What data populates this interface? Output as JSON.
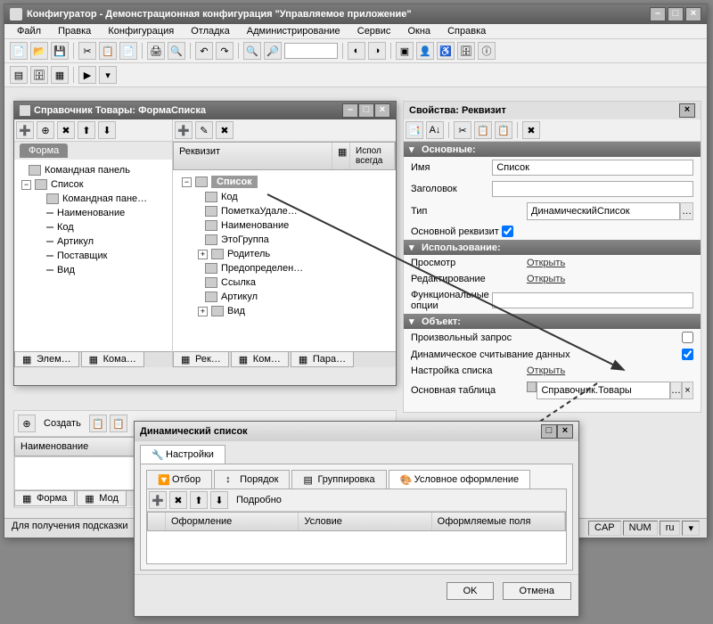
{
  "main_window": {
    "title": "Конфигуратор - Демонстрационная конфигурация \"Управляемое приложение\""
  },
  "menu": {
    "items": [
      "Файл",
      "Правка",
      "Конфигурация",
      "Отладка",
      "Администрирование",
      "Сервис",
      "Окна",
      "Справка"
    ]
  },
  "form_panel": {
    "title": "Справочник Товары: ФормаСписка",
    "tab_form": "Форма",
    "tree_items": [
      "Командная панель",
      "Список",
      "Командная пане…",
      "Наименование",
      "Код",
      "Артикул",
      "Поставщик",
      "Вид"
    ],
    "bottom_tabs": [
      "Элем…",
      "Кома…"
    ]
  },
  "rekvizit": {
    "header_col1": "Реквизит",
    "header_col2": "Испол\nвсегда",
    "items": [
      "Список",
      "Код",
      "ПометкаУдале…",
      "Наименование",
      "ЭтоГруппа",
      "Родитель",
      "Предопределен…",
      "Ссылка",
      "Артикул",
      "Вид"
    ],
    "bottom_tabs": [
      "Рек…",
      "Ком…",
      "Пара…"
    ]
  },
  "props_panel": {
    "title": "Свойства: Реквизит",
    "sections": {
      "main": "Основные:",
      "use": "Использование:",
      "object": "Объект:"
    },
    "fields": {
      "name_label": "Имя",
      "name_value": "Список",
      "zagolovok_label": "Заголовок",
      "zagolovok_value": "",
      "tip_label": "Тип",
      "tip_value": "ДинамическийСписок",
      "main_rekvizit_label": "Основной реквизит",
      "main_rekvizit_checked": true,
      "prosmotr_label": "Просмотр",
      "prosmotr_link": "Открыть",
      "redakt_label": "Редактирование",
      "redakt_link": "Открыть",
      "func_opt_label": "Функциональные опции",
      "func_opt_value": "",
      "proizv_label": "Произвольный запрос",
      "proizv_checked": false,
      "dyn_read_label": "Динамическое считывание данных",
      "dyn_read_checked": true,
      "nastroyka_label": "Настройка списка",
      "nastroyka_link": "Открыть",
      "osn_tab_label": "Основная таблица",
      "osn_tab_value": "Справочник.Товары"
    }
  },
  "sub_panel": {
    "create": "Создать",
    "col_name": "Наименование",
    "bottom_tabs": [
      "Форма",
      "Мод"
    ]
  },
  "dyn_dialog": {
    "title": "Динамический список",
    "main_tab": "Настройки",
    "tabs": [
      "Отбор",
      "Порядок",
      "Группировка",
      "Условное оформление"
    ],
    "detail": "Подробно",
    "cols": [
      "Оформление",
      "Условие",
      "Оформляемые поля"
    ],
    "ok": "OK",
    "cancel": "Отмена"
  },
  "statusbar": {
    "hint": "Для получения подсказки",
    "ind": [
      "CAP",
      "NUM",
      "ru"
    ]
  }
}
